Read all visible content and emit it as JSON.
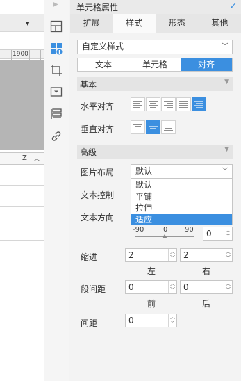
{
  "sheet": {
    "toolbar_dropdown": "▾",
    "ruler_label": "1900",
    "column_label": "Z",
    "scroll_up": "︿"
  },
  "panel": {
    "title": "单元格属性",
    "tabs": [
      {
        "label": "扩展"
      },
      {
        "label": "样式",
        "active": true
      },
      {
        "label": "形态"
      },
      {
        "label": "其他"
      }
    ],
    "style_select": "自定义样式",
    "segments": [
      {
        "label": "文本"
      },
      {
        "label": "单元格"
      },
      {
        "label": "对齐",
        "active": true
      }
    ],
    "basic": {
      "title": "基本",
      "h_align_label": "水平对齐",
      "v_align_label": "垂直对齐"
    },
    "advanced": {
      "title": "高级",
      "image_layout_label": "图片布局",
      "image_layout_value": "默认",
      "image_layout_options": [
        "默认",
        "平铺",
        "拉伸",
        "适应"
      ],
      "image_layout_highlight": "适应",
      "text_control_label": "文本控制",
      "text_direction_label": "文本方向",
      "scale_min": "-90",
      "scale_mid": "0",
      "scale_max": "90",
      "rotation_value": "0",
      "indent_label": "缩进",
      "indent_left": "2",
      "indent_right": "2",
      "left_label": "左",
      "right_label": "右",
      "para_spacing_label": "段间距",
      "para_before": "0",
      "para_after": "0",
      "before_label": "前",
      "after_label": "后",
      "spacing_label": "间距",
      "spacing_value": "0"
    }
  },
  "colors": {
    "accent": "#3b8fe0",
    "panel_bg": "#f3f3f3",
    "section_bg": "#e4e4e4"
  }
}
